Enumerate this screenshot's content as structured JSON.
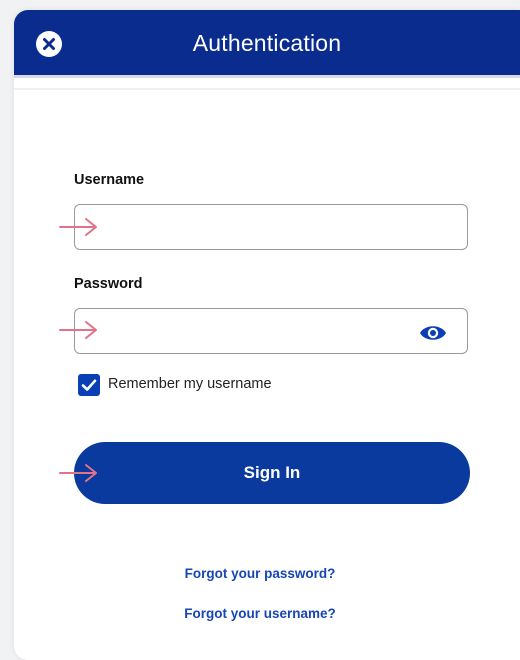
{
  "header": {
    "title": "Authentication",
    "close_icon": "close-circle-icon",
    "background_color": "#0a2c8f"
  },
  "form": {
    "username": {
      "label": "Username",
      "value": "",
      "placeholder": ""
    },
    "password": {
      "label": "Password",
      "value": "",
      "placeholder": "",
      "toggle_icon": "eye-icon"
    },
    "remember": {
      "label": "Remember my username",
      "checked": true
    },
    "submit_label": "Sign In"
  },
  "links": {
    "forgot_password": "Forgot your password?",
    "forgot_username": "Forgot your username?"
  },
  "annotations": {
    "arrow_icon": "arrow-right-icon",
    "arrow_color": "#e0728a"
  },
  "colors": {
    "primary": "#0a3a9e",
    "link": "#1646b3"
  }
}
